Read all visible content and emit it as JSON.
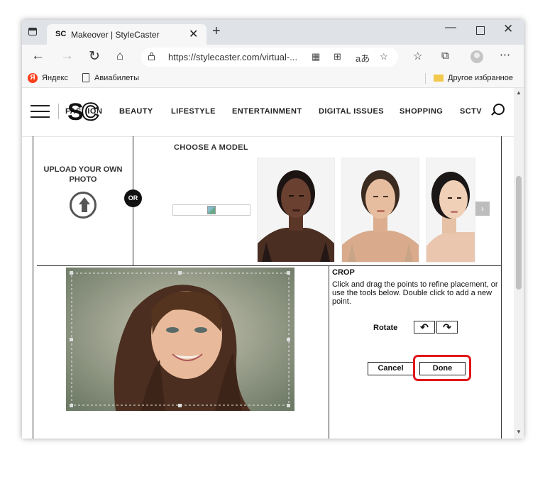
{
  "browser": {
    "tab_title": "Makeover | StyleCaster",
    "tab_favicon_text": "SC",
    "url": "https://stylecaster.com/virtual-...",
    "reader_badge": "aあ",
    "bookmarks": [
      {
        "label": "Яндекс",
        "icon": "yandex-icon"
      },
      {
        "label": "Авиабилеты",
        "icon": "document-icon"
      }
    ],
    "other_favorites": "Другое избранное"
  },
  "site": {
    "logo": "SC",
    "nav": [
      "FASHION",
      "BEAUTY",
      "LIFESTYLE",
      "ENTERTAINMENT",
      "DIGITAL ISSUES",
      "SHOPPING",
      "SCTV"
    ]
  },
  "makeover": {
    "upload_label": "UPLOAD YOUR OWN PHOTO",
    "or_label": "OR",
    "choose_model_label": "CHOOSE A MODEL",
    "next_arrow": "›",
    "crop": {
      "title": "CROP",
      "instructions": "Click and drag the points to refine placement, or use the tools below. Double click to add a new point.",
      "rotate_label": "Rotate",
      "cancel_label": "Cancel",
      "done_label": "Done"
    }
  },
  "colors": {
    "highlight": "#e0171b",
    "yandex": "#fc3f1d"
  }
}
